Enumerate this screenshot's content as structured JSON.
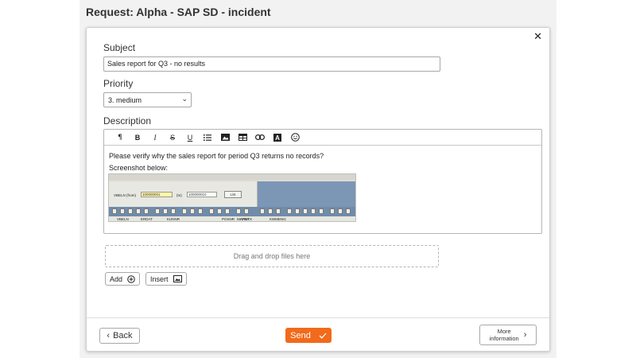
{
  "page": {
    "title": "Request: Alpha - SAP SD - incident"
  },
  "form": {
    "subject_label": "Subject",
    "subject_value": "Sales report for Q3 - no results",
    "priority_label": "Priority",
    "priority_value": "3. medium",
    "description_label": "Description",
    "description_lines": [
      "Please verify why the sales report for period Q3 returns no records?",
      "Screenshot below:"
    ],
    "toolbar_icons": [
      "paragraph-icon",
      "bold-icon",
      "italic-icon",
      "strikethrough-icon",
      "underline-icon",
      "list-icon",
      "image-icon",
      "table-icon",
      "link-icon",
      "text-color-icon",
      "emoji-icon"
    ],
    "embedded_screenshot": {
      "vbeln_from_label": "VBELN (from)",
      "vbeln_from_value": "100000001",
      "to_label": "(to)",
      "to_value": "100000010",
      "list_button": "List",
      "columns": [
        "VBELN",
        "ERDAT",
        "KUNNR",
        "POSNR",
        "MATNR",
        "ARKTX",
        "KWMENG"
      ]
    },
    "dropzone_text": "Drag and drop files here",
    "add_label": "Add",
    "insert_label": "Insert"
  },
  "footer": {
    "back_label": "Back",
    "send_label": "Send",
    "more_line1": "More",
    "more_line2": "information"
  },
  "colors": {
    "accent": "#f26a1b"
  }
}
